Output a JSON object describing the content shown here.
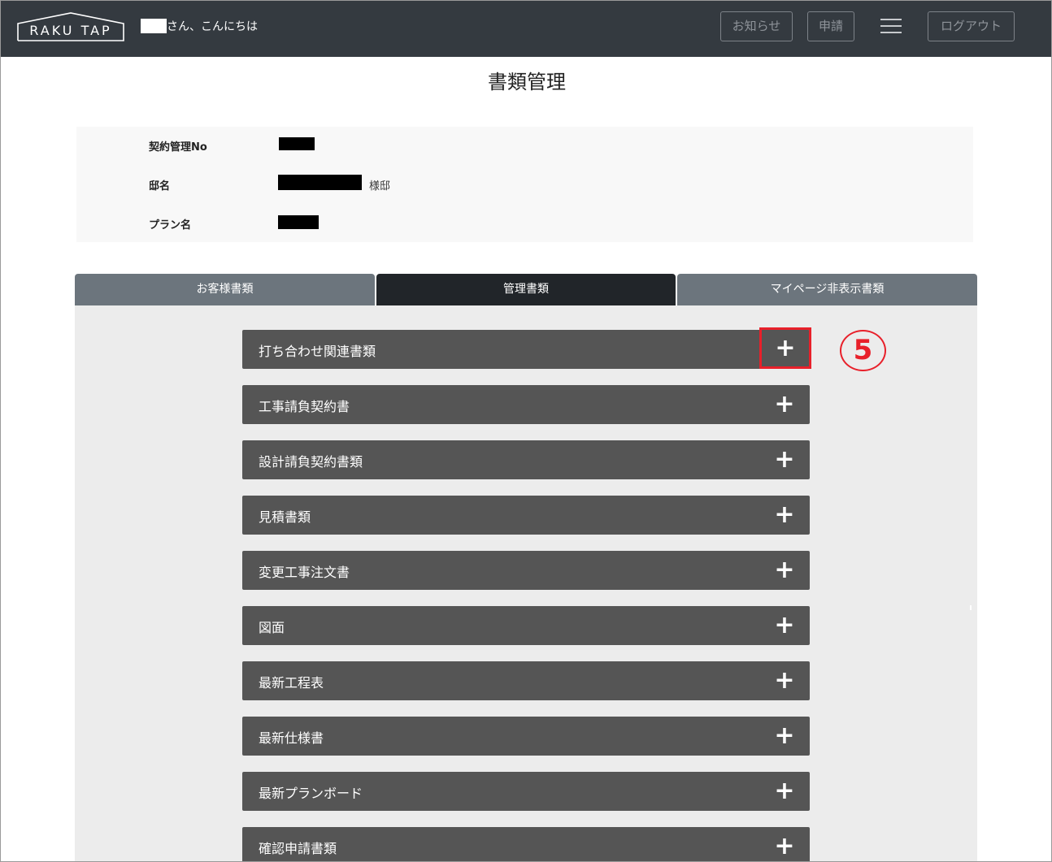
{
  "header": {
    "logo_text": "RAKU TAP",
    "greeting": "さん、こんにちは",
    "buttons": {
      "notice": "お知らせ",
      "apply": "申請",
      "logout": "ログアウト"
    },
    "bg_color": "#343a40"
  },
  "page": {
    "title": "書類管理"
  },
  "info": {
    "contract_no_label": "契約管理No",
    "residence_label": "邸名",
    "residence_suffix": "様邸",
    "plan_label": "プラン名"
  },
  "tabs": [
    {
      "label": "お客様書類",
      "active": false
    },
    {
      "label": "管理書類",
      "active": true
    },
    {
      "label": "マイページ非表示書類",
      "active": false
    }
  ],
  "accordion": [
    {
      "label": "打ち合わせ関連書類",
      "icon": "plus-icon",
      "highlighted": true
    },
    {
      "label": "工事請負契約書",
      "icon": "plus-icon"
    },
    {
      "label": "設計請負契約書類",
      "icon": "plus-icon"
    },
    {
      "label": "見積書類",
      "icon": "plus-icon"
    },
    {
      "label": "変更工事注文書",
      "icon": "plus-icon"
    },
    {
      "label": "図面",
      "icon": "plus-icon"
    },
    {
      "label": "最新工程表",
      "icon": "plus-icon"
    },
    {
      "label": "最新仕様書",
      "icon": "plus-icon"
    },
    {
      "label": "最新プランボード",
      "icon": "plus-icon"
    },
    {
      "label": "確認申請書類",
      "icon": "plus-icon"
    }
  ],
  "plus_symbol": "+",
  "step_marker": "5",
  "accent_color": "#e8202a"
}
